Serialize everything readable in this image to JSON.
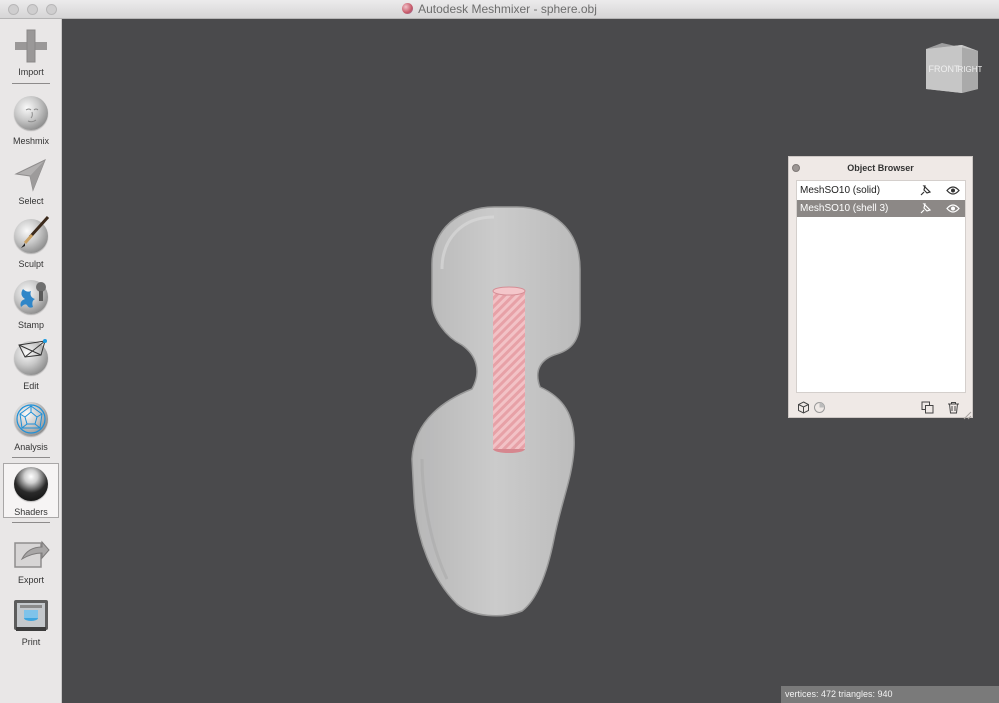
{
  "window": {
    "title": "Autodesk Meshmixer - sphere.obj"
  },
  "toolbar": {
    "items": [
      {
        "label": "Import",
        "icon": "plus-icon"
      },
      {
        "label": "Meshmix",
        "icon": "face-sphere-icon"
      },
      {
        "label": "Select",
        "icon": "arrow-select-icon"
      },
      {
        "label": "Sculpt",
        "icon": "brush-sphere-icon"
      },
      {
        "label": "Stamp",
        "icon": "stamp-sphere-icon"
      },
      {
        "label": "Edit",
        "icon": "edit-sphere-icon"
      },
      {
        "label": "Analysis",
        "icon": "analysis-sphere-icon"
      },
      {
        "label": "Shaders",
        "icon": "shaders-sphere-icon",
        "active": true
      },
      {
        "label": "Export",
        "icon": "export-icon"
      },
      {
        "label": "Print",
        "icon": "printer-icon"
      }
    ]
  },
  "navcube": {
    "front": "FRONT",
    "right": "RIGHT"
  },
  "object_browser": {
    "title": "Object Browser",
    "rows": [
      {
        "label": "MeshSO10 (solid)",
        "selected": false
      },
      {
        "label": "MeshSO10 (shell 3)",
        "selected": true
      }
    ]
  },
  "status": {
    "text": "vertices: 472 triangles: 940"
  },
  "colors": {
    "viewport_bg": "#4a4a4c",
    "mesh": "#c9c9c9",
    "cylinder": "#e8a3a8",
    "selected_row": "#8c8886"
  }
}
